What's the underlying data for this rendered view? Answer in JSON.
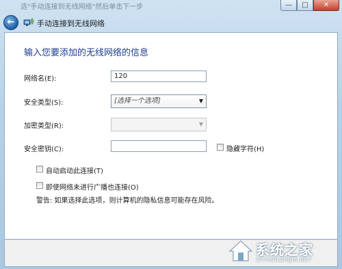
{
  "window": {
    "background_title": "选\"手动连接到无线网络\"然后单击下一步",
    "caption_buttons": {
      "minimize": "—",
      "maximize": "□",
      "close": "✕"
    }
  },
  "nav": {
    "back_icon": "back-arrow-icon",
    "title": "手动连接到无线网络"
  },
  "form": {
    "heading": "输入您要添加的无线网络的信息",
    "network_name_label": "网络名(E):",
    "network_name_value": "120",
    "security_type_label": "安全类型(S):",
    "security_type_value": "[选择一个选项]",
    "encryption_type_label": "加密类型(R):",
    "encryption_type_value": "",
    "security_key_label": "安全密钥(C):",
    "security_key_value": "",
    "hide_chars_label": "隐藏字符(H)",
    "auto_connect_label": "自动启动此连接(T)",
    "connect_hidden_label": "即使网络未进行广播也连接(O)",
    "warning": "警告: 如果选择此选项，则计算机的隐私信息可能存在风险。"
  },
  "watermark": {
    "text": "系统之家",
    "url": "XITONGZHIJIA.NET"
  }
}
